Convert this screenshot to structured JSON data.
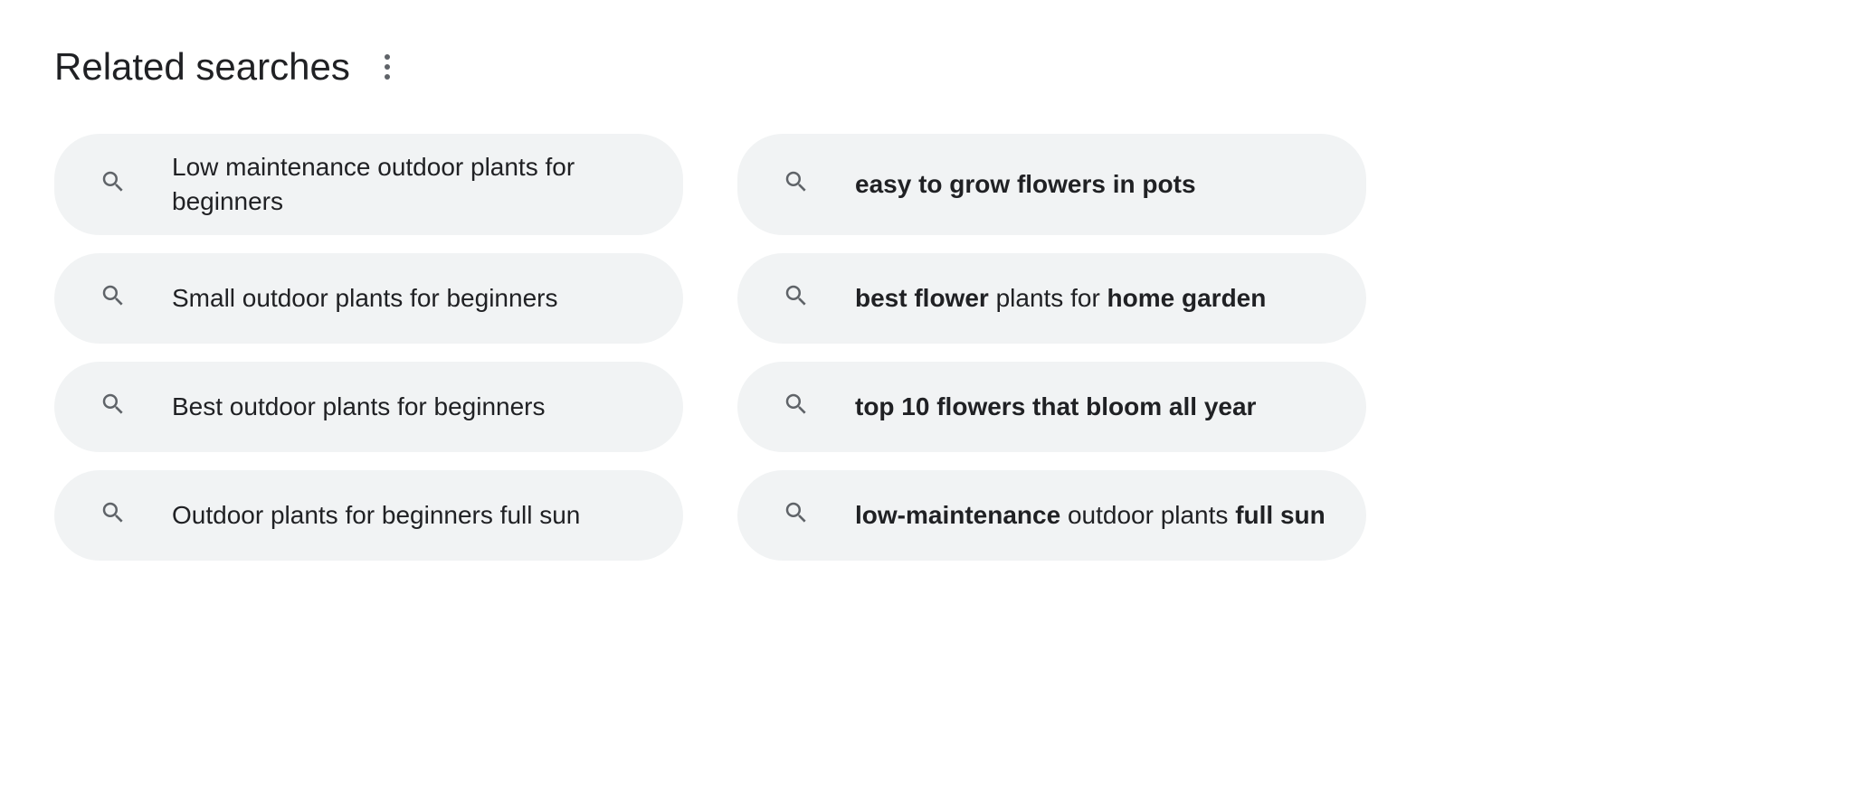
{
  "heading": "Related searches",
  "items": [
    {
      "segments": [
        {
          "text": "Low maintenance outdoor plants for beginners",
          "bold": false
        }
      ]
    },
    {
      "segments": [
        {
          "text": "easy to grow flowers in pots",
          "bold": true
        }
      ]
    },
    {
      "segments": [
        {
          "text": "Small outdoor plants for beginners",
          "bold": false
        }
      ]
    },
    {
      "segments": [
        {
          "text": "best flower",
          "bold": true
        },
        {
          "text": " plants for ",
          "bold": false
        },
        {
          "text": "home garden",
          "bold": true
        }
      ]
    },
    {
      "segments": [
        {
          "text": "Best outdoor plants for beginners",
          "bold": false
        }
      ]
    },
    {
      "segments": [
        {
          "text": "top 10 flowers that bloom all year",
          "bold": true
        }
      ]
    },
    {
      "segments": [
        {
          "text": "Outdoor plants for beginners full sun",
          "bold": false
        }
      ]
    },
    {
      "segments": [
        {
          "text": "low-maintenance",
          "bold": true
        },
        {
          "text": " outdoor plants ",
          "bold": false
        },
        {
          "text": "full sun",
          "bold": true
        }
      ]
    }
  ]
}
